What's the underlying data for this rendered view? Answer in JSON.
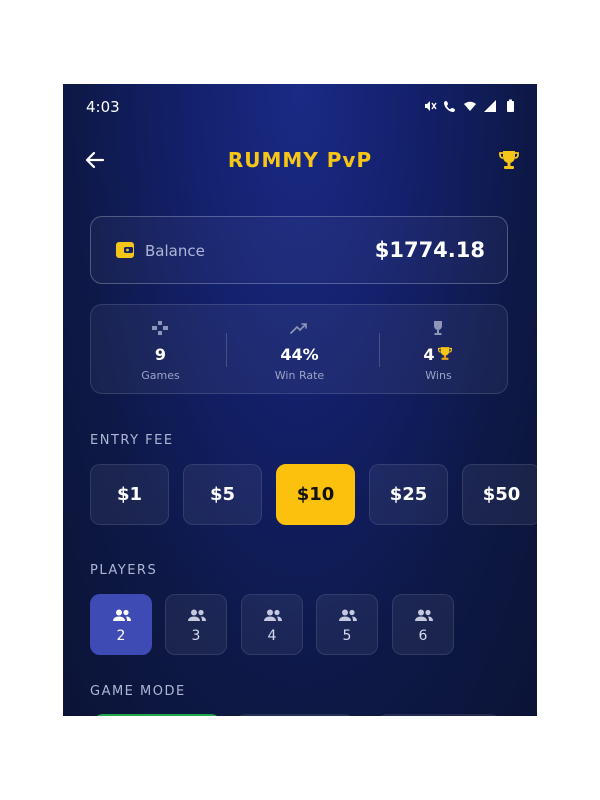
{
  "status_bar": {
    "time": "4:03",
    "icons": [
      "mute-icon",
      "call-icon",
      "wifi-icon",
      "signal-icon",
      "battery-icon"
    ]
  },
  "header": {
    "title": "RUMMY PvP",
    "back_icon": "back-arrow-icon",
    "trophy_icon": "trophy-icon"
  },
  "balance": {
    "label": "Balance",
    "amount": "$1774.18",
    "icon": "wallet-icon"
  },
  "stats": [
    {
      "value": "9",
      "label": "Games",
      "icon": "gamepad-icon"
    },
    {
      "value": "44%",
      "label": "Win Rate",
      "icon": "trending-up-icon"
    },
    {
      "value": "4",
      "label": "Wins",
      "icon": "trophy-icon"
    }
  ],
  "entry_fee": {
    "label": "ENTRY FEE",
    "options": [
      "$1",
      "$5",
      "$10",
      "$25",
      "$50"
    ],
    "selected": "$10"
  },
  "players": {
    "label": "PLAYERS",
    "options": [
      "2",
      "3",
      "4",
      "5",
      "6"
    ],
    "selected": "2"
  },
  "game_mode": {
    "label": "GAME MODE"
  },
  "colors": {
    "accent": "#f5c518",
    "selected_fee": "#fbc10c",
    "selected_player": "#3e4bb4",
    "mode_peek": "#1fa84a"
  }
}
